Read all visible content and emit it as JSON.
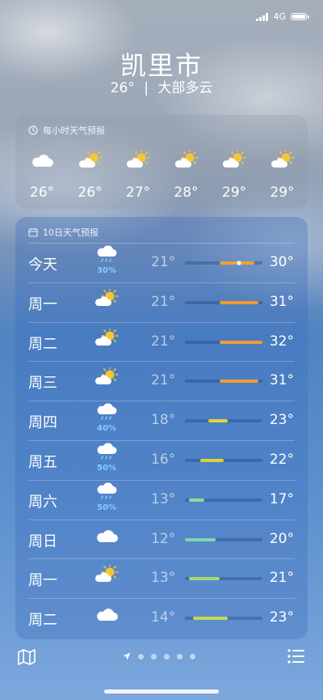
{
  "status": {
    "network": "4G"
  },
  "location": {
    "city": "凯里市",
    "current_temp": "26°",
    "separator": "|",
    "condition": "大部多云"
  },
  "hourly": {
    "title": "每小时天气预报",
    "items": [
      {
        "icon": "cloud-icon",
        "temp": "26°"
      },
      {
        "icon": "partly-cloudy-icon",
        "temp": "26°"
      },
      {
        "icon": "partly-cloudy-icon",
        "temp": "27°"
      },
      {
        "icon": "partly-cloudy-icon",
        "temp": "28°"
      },
      {
        "icon": "partly-cloudy-icon",
        "temp": "29°"
      },
      {
        "icon": "partly-cloudy-icon",
        "temp": "29°"
      }
    ]
  },
  "daily": {
    "title": "10日天气预报",
    "range_min": 12,
    "range_max": 32,
    "current_temp_value": 26,
    "days": [
      {
        "day": "今天",
        "icon": "rain-cloud-icon",
        "precip": "30%",
        "low": "21°",
        "high": "30°",
        "low_v": 21,
        "high_v": 30,
        "color": "#f0a030",
        "current": true
      },
      {
        "day": "周一",
        "icon": "partly-cloudy-icon",
        "precip": "",
        "low": "21°",
        "high": "31°",
        "low_v": 21,
        "high_v": 31,
        "color": "#f09a30"
      },
      {
        "day": "周二",
        "icon": "partly-cloudy-icon",
        "precip": "",
        "low": "21°",
        "high": "32°",
        "low_v": 21,
        "high_v": 32,
        "color": "#f09a30"
      },
      {
        "day": "周三",
        "icon": "partly-cloudy-icon",
        "precip": "",
        "low": "21°",
        "high": "31°",
        "low_v": 21,
        "high_v": 31,
        "color": "#f09a30"
      },
      {
        "day": "周四",
        "icon": "rain-cloud-icon",
        "precip": "40%",
        "low": "18°",
        "high": "23°",
        "low_v": 18,
        "high_v": 23,
        "color": "#e6d23a"
      },
      {
        "day": "周五",
        "icon": "rain-cloud-icon",
        "precip": "50%",
        "low": "16°",
        "high": "22°",
        "low_v": 16,
        "high_v": 22,
        "color": "#d9d23a"
      },
      {
        "day": "周六",
        "icon": "rain-cloud-icon",
        "precip": "50%",
        "low": "13°",
        "high": "17°",
        "low_v": 13,
        "high_v": 17,
        "color": "#8fd79a"
      },
      {
        "day": "周日",
        "icon": "cloud-icon",
        "precip": "",
        "low": "12°",
        "high": "20°",
        "low_v": 12,
        "high_v": 20,
        "color": "#7fd6b0"
      },
      {
        "day": "周一",
        "icon": "partly-cloudy-icon",
        "precip": "",
        "low": "13°",
        "high": "21°",
        "low_v": 13,
        "high_v": 21,
        "color": "#a6d870"
      },
      {
        "day": "周二",
        "icon": "cloud-icon",
        "precip": "",
        "low": "14°",
        "high": "23°",
        "low_v": 14,
        "high_v": 23,
        "color": "#c8d850"
      }
    ]
  },
  "bottom": {
    "map_icon": "map-icon",
    "location_icon": "location-arrow-icon",
    "list_icon": "list-icon",
    "pages": 5
  }
}
